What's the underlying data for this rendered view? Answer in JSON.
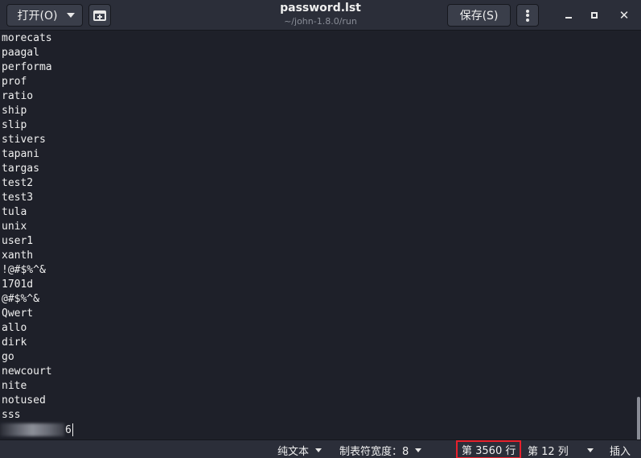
{
  "header": {
    "open_button": "打开(O)",
    "title": "password.lst",
    "subtitle": "~/john-1.8.0/run",
    "save_button": "保存(S)"
  },
  "editor": {
    "lines": [
      "morecats",
      "paagal",
      "performa",
      "prof",
      "ratio",
      "ship",
      "slip",
      "stivers",
      "tapani",
      "targas",
      "test2",
      "test3",
      "tula",
      "unix",
      "user1",
      "xanth",
      "!@#$%^&",
      "1701d",
      "@#$%^&",
      "Qwert",
      "allo",
      "dirk",
      "go",
      "newcourt",
      "nite",
      "notused",
      "sss"
    ],
    "last_line_visible_tail": "6"
  },
  "statusbar": {
    "language": "纯文本",
    "tab_width": "制表符宽度：8",
    "line": "第 3560 行",
    "column": "第 12 列",
    "mode": "插入"
  },
  "colors": {
    "background": "#1e2029",
    "headerbar": "#2b2e39",
    "text": "#f0f0f0",
    "highlight_box": "#e8202c"
  },
  "icons": [
    "new-tab-icon",
    "vertical-dots-menu-icon",
    "minimize-icon",
    "maximize-icon",
    "close-icon"
  ]
}
